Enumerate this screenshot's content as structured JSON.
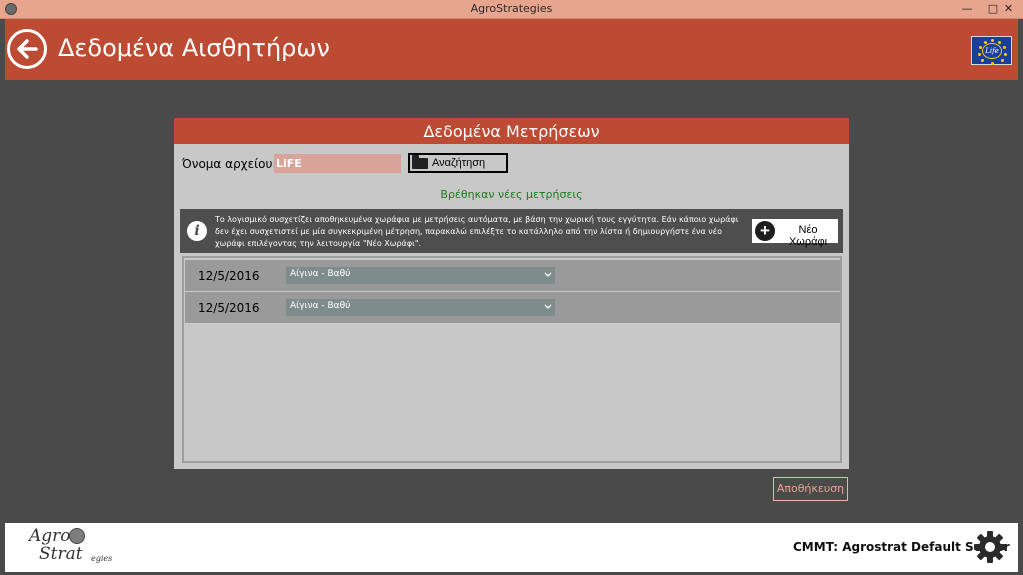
{
  "window": {
    "title": "AgroStrategies",
    "min_glyph": "—",
    "max_glyph": "□",
    "close_glyph": "✕"
  },
  "header": {
    "title": "Δεδομένα Αισθητήρων",
    "back_icon": "back-arrow-icon",
    "flag_text": "Life",
    "accent_color": "#bd4a32"
  },
  "panel": {
    "title": "Δεδομένα Μετρήσεων",
    "file_label": "Όνομα αρχείου:",
    "file_value": "LiFE",
    "search_label": "Αναζήτηση",
    "found_message": "Βρέθηκαν νέες μετρήσεις",
    "info_text": "Το λογισμικό συσχετίζει αποθηκευμένα χωράφια με μετρήσεις αυτόματα, με βάση την χωρική τους εγγύτητα. Εάν κάποιο χωράφι δεν έχει συσχετιστεί με μία συγκεκριμένη μέτρηση, παρακαλώ επιλέξτε το κατάλληλο από την λίστα ή δημιουργήστε ένα νέο χωράφι επιλέγοντας την λειτουργία \"Νέο Χωράφι\".",
    "new_field_label": "Νέο Χωράφι",
    "rows": [
      {
        "date": "12/5/2016",
        "field": "Αίγινα - Βαθύ"
      },
      {
        "date": "12/5/2016",
        "field": "Αίγινα - Βαθύ"
      }
    ]
  },
  "actions": {
    "save_label": "Αποθήκευση"
  },
  "footer": {
    "logo_agro": "Agro",
    "logo_strat": "Strat",
    "logo_egies": "egies",
    "server_text": "CMMT: Agrostrat Default Server"
  }
}
